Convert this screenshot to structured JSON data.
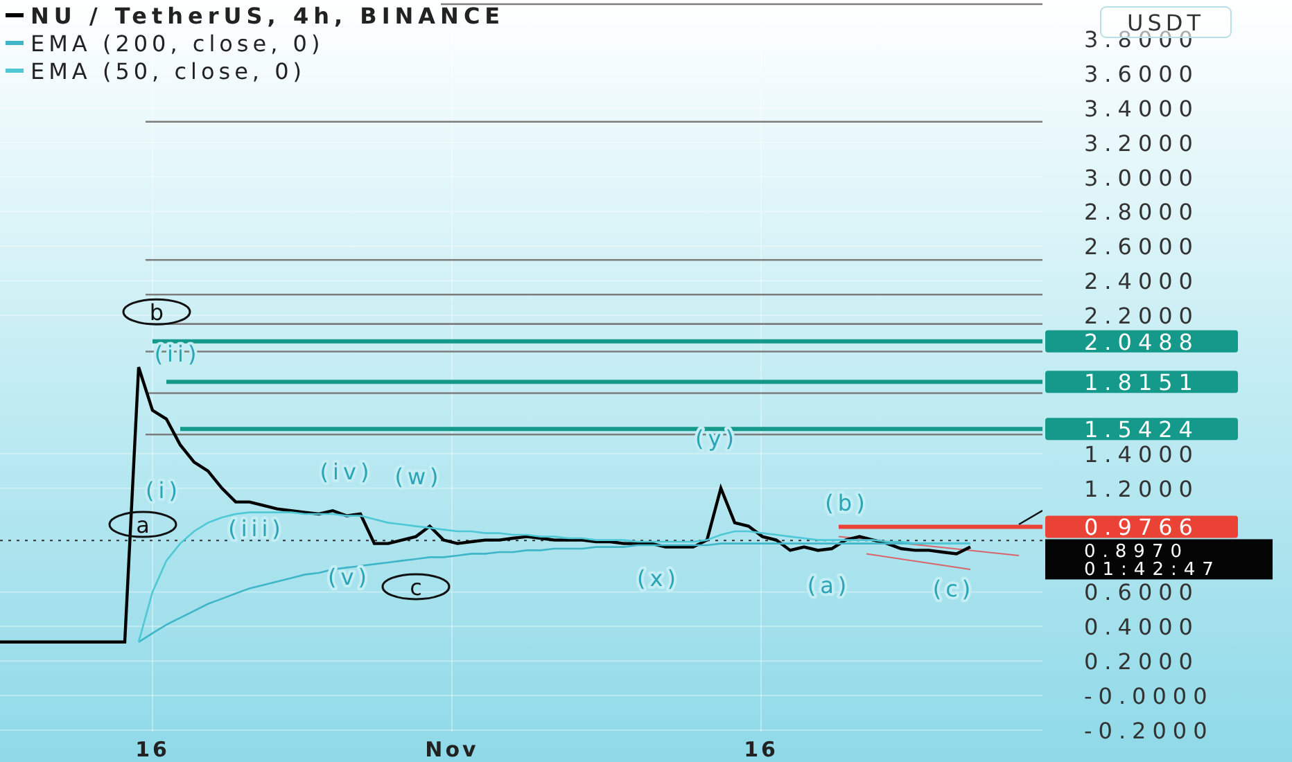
{
  "chart_data": {
    "type": "line",
    "legend": "upper left",
    "series": [
      {
        "name": "NU / TetherUS, 4h, BINANCE",
        "color": "#000000",
        "values": [
          0.31,
          0.31,
          0.31,
          0.31,
          0.31,
          0.31,
          0.31,
          0.31,
          0.31,
          0.31,
          1.9,
          1.65,
          1.6,
          1.45,
          1.35,
          1.3,
          1.2,
          1.12,
          1.12,
          1.1,
          1.08,
          1.07,
          1.06,
          1.05,
          1.07,
          1.04,
          1.05,
          0.88,
          0.88,
          0.9,
          0.92,
          0.98,
          0.9,
          0.88,
          0.89,
          0.9,
          0.9,
          0.91,
          0.92,
          0.91,
          0.9,
          0.9,
          0.9,
          0.89,
          0.89,
          0.88,
          0.88,
          0.88,
          0.86,
          0.86,
          0.86,
          0.9,
          1.2,
          1.0,
          0.98,
          0.92,
          0.9,
          0.84,
          0.86,
          0.84,
          0.85,
          0.9,
          0.92,
          0.9,
          0.88,
          0.85,
          0.84,
          0.84,
          0.83,
          0.82,
          0.86
        ]
      },
      {
        "name": "EMA (200, close, 0)",
        "color": "#3fb6c8",
        "values": [
          null,
          null,
          null,
          null,
          null,
          null,
          null,
          null,
          null,
          null,
          0.31,
          0.36,
          0.41,
          0.45,
          0.49,
          0.53,
          0.56,
          0.59,
          0.62,
          0.64,
          0.66,
          0.68,
          0.7,
          0.71,
          0.73,
          0.74,
          0.75,
          0.76,
          0.77,
          0.78,
          0.79,
          0.8,
          0.8,
          0.81,
          0.82,
          0.82,
          0.83,
          0.83,
          0.84,
          0.84,
          0.85,
          0.85,
          0.85,
          0.86,
          0.86,
          0.86,
          0.87,
          0.87,
          0.87,
          0.87,
          0.87,
          0.87,
          0.88,
          0.88,
          0.88,
          0.88,
          0.88,
          0.88,
          0.88,
          0.88,
          0.88,
          0.88,
          0.88,
          0.88,
          0.88,
          0.88,
          0.88,
          0.88,
          0.88,
          0.88,
          0.88
        ]
      },
      {
        "name": "EMA (50, close, 0)",
        "color": "#4fc8d6",
        "values": [
          null,
          null,
          null,
          null,
          null,
          null,
          null,
          null,
          null,
          null,
          0.31,
          0.6,
          0.78,
          0.88,
          0.95,
          1.0,
          1.03,
          1.05,
          1.06,
          1.06,
          1.06,
          1.06,
          1.05,
          1.05,
          1.05,
          1.04,
          1.04,
          1.02,
          1.0,
          0.99,
          0.98,
          0.97,
          0.96,
          0.95,
          0.95,
          0.94,
          0.94,
          0.93,
          0.93,
          0.92,
          0.92,
          0.91,
          0.91,
          0.9,
          0.9,
          0.9,
          0.89,
          0.89,
          0.89,
          0.89,
          0.89,
          0.9,
          0.93,
          0.95,
          0.95,
          0.94,
          0.93,
          0.92,
          0.91,
          0.9,
          0.9,
          0.9,
          0.9,
          0.9,
          0.89,
          0.89,
          0.88,
          0.88,
          0.88,
          0.88,
          0.88
        ]
      }
    ],
    "yticks": [
      {
        "value": 3.8,
        "label": "3.8000"
      },
      {
        "value": 3.6,
        "label": "3.6000"
      },
      {
        "value": 3.4,
        "label": "3.4000"
      },
      {
        "value": 3.2,
        "label": "3.2000"
      },
      {
        "value": 3.0,
        "label": "3.0000"
      },
      {
        "value": 2.8,
        "label": "2.8000"
      },
      {
        "value": 2.6,
        "label": "2.6000"
      },
      {
        "value": 2.4,
        "label": "2.4000"
      },
      {
        "value": 2.2,
        "label": "2.2000"
      },
      {
        "value": 1.4,
        "label": "1.4000"
      },
      {
        "value": 1.2,
        "label": "1.2000"
      },
      {
        "value": 0.6,
        "label": "0.6000"
      },
      {
        "value": 0.4,
        "label": "0.4000"
      },
      {
        "value": 0.2,
        "label": "0.2000"
      },
      {
        "value": 0.0,
        "label": "-0.0000"
      },
      {
        "value": -0.2,
        "label": "-0.2000"
      }
    ],
    "ylim": [
      -0.2,
      4.0
    ],
    "grid": true,
    "ref_lines": [
      {
        "axis": "y",
        "value": 4.0,
        "color": "#7d7d7d"
      },
      {
        "axis": "y",
        "value": 3.32,
        "color": "#7d7d7d"
      },
      {
        "axis": "y",
        "value": 2.52,
        "color": "#7d7d7d"
      },
      {
        "axis": "y",
        "value": 2.32,
        "color": "#7d7d7d"
      },
      {
        "axis": "y",
        "value": 2.15,
        "color": "#7d7d7d"
      },
      {
        "axis": "y",
        "value": 1.99,
        "color": "#7d7d7d"
      },
      {
        "axis": "y",
        "value": 1.75,
        "color": "#7d7d7d"
      },
      {
        "axis": "y",
        "value": 1.51,
        "color": "#7d7d7d"
      },
      {
        "axis": "y",
        "value": 2.0488,
        "label": "2.0488",
        "color": "#14998a"
      },
      {
        "axis": "y",
        "value": 1.8151,
        "label": "1.8151",
        "color": "#14998a"
      },
      {
        "axis": "y",
        "value": 1.5424,
        "label": "1.5424",
        "color": "#14998a"
      },
      {
        "axis": "y",
        "value": 0.9766,
        "label": "0.9766",
        "color": "#ea4335"
      },
      {
        "axis": "y",
        "value": 0.897,
        "color": "#333333"
      }
    ]
  },
  "time_axis": [
    "16",
    "Nov",
    "16"
  ],
  "wave_labels": [
    {
      "kind": "circled",
      "text": "b"
    },
    {
      "kind": "plain",
      "text": "(ii)"
    },
    {
      "kind": "plain",
      "text": "(i)"
    },
    {
      "kind": "circled",
      "text": "a"
    },
    {
      "kind": "plain",
      "text": "(iii)"
    },
    {
      "kind": "plain",
      "text": "(iv)"
    },
    {
      "kind": "plain",
      "text": "(w)"
    },
    {
      "kind": "plain",
      "text": "(v)"
    },
    {
      "kind": "circled",
      "text": "c"
    },
    {
      "kind": "plain",
      "text": "(y)"
    },
    {
      "kind": "plain",
      "text": "(x)"
    },
    {
      "kind": "plain",
      "text": "(b)"
    },
    {
      "kind": "plain",
      "text": "(a)"
    },
    {
      "kind": "plain",
      "text": "(c)"
    }
  ],
  "currency": "USDT",
  "last_price": {
    "price": "0.8970",
    "countdown": "01:42:47"
  }
}
